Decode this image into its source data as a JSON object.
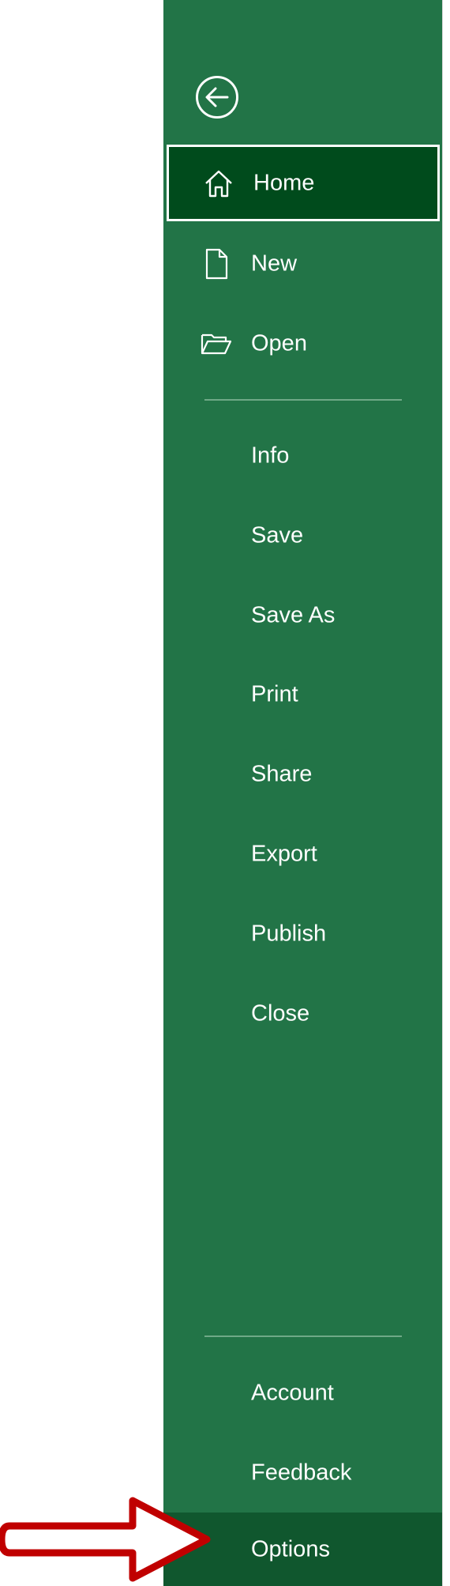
{
  "backstage": {
    "background_color": "#227447",
    "selected_color": "#004b1c",
    "hover_color": "#10572e",
    "back_button_icon": "arrow-left-circle-icon",
    "top_items": [
      {
        "key": "home",
        "label": "Home",
        "icon": "home-icon"
      },
      {
        "key": "new",
        "label": "New",
        "icon": "blank-document-icon"
      },
      {
        "key": "open",
        "label": "Open",
        "icon": "open-folder-icon"
      }
    ],
    "middle_items": [
      {
        "key": "info",
        "label": "Info"
      },
      {
        "key": "save",
        "label": "Save"
      },
      {
        "key": "save_as",
        "label": "Save As"
      },
      {
        "key": "print",
        "label": "Print"
      },
      {
        "key": "share",
        "label": "Share"
      },
      {
        "key": "export",
        "label": "Export"
      },
      {
        "key": "publish",
        "label": "Publish"
      },
      {
        "key": "close",
        "label": "Close"
      }
    ],
    "bottom_items": [
      {
        "key": "account",
        "label": "Account"
      },
      {
        "key": "feedback",
        "label": "Feedback"
      },
      {
        "key": "options",
        "label": "Options"
      }
    ],
    "selected_item": "Home",
    "highlighted_item": "Options"
  },
  "annotation": {
    "arrow_color": "#c00000",
    "arrow_icon": "red-outline-arrow-right-icon"
  }
}
